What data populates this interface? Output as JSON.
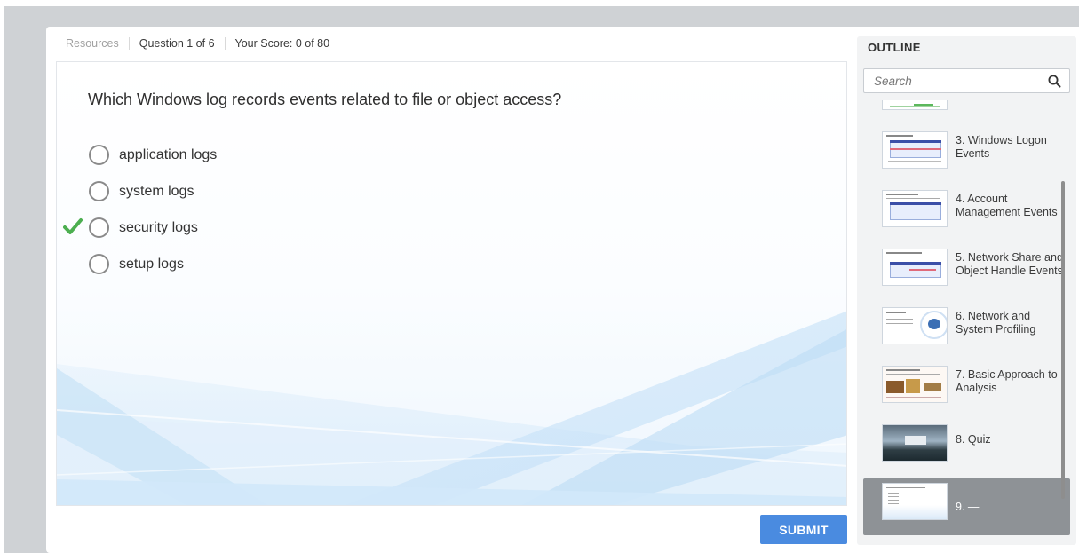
{
  "topbar": {
    "resources": "Resources",
    "question_counter": "Question 1 of 6",
    "score": "Your Score: 0 of 80"
  },
  "quiz": {
    "question": "Which Windows log records events related to file or object access?",
    "options": [
      {
        "label": "application logs",
        "correct": false
      },
      {
        "label": "system logs",
        "correct": false
      },
      {
        "label": "security logs",
        "correct": true
      },
      {
        "label": "setup logs",
        "correct": false
      }
    ],
    "submit_label": "SUBMIT"
  },
  "outline": {
    "title": "OUTLINE",
    "search_placeholder": "Search",
    "items": [
      {
        "label": "3. Windows Logon Events"
      },
      {
        "label": "4. Account Management Events"
      },
      {
        "label": "5. Network Share and Object Handle Events"
      },
      {
        "label": "6. Network and System Profiling"
      },
      {
        "label": "7. Basic Approach to Analysis"
      },
      {
        "label": "8. Quiz"
      },
      {
        "label": "9. —",
        "selected": true
      }
    ]
  },
  "colors": {
    "accent": "#4a8be0",
    "check": "#4caf50",
    "selected_item": "#8e9296"
  }
}
